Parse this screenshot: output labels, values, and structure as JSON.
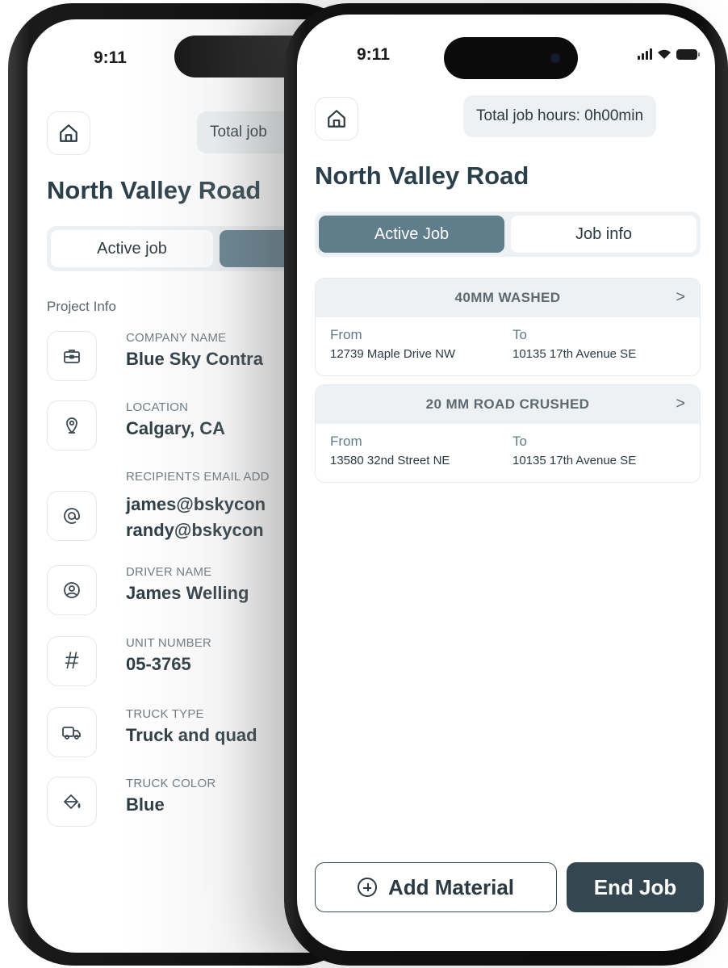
{
  "back_screen": {
    "time": "9:11",
    "hours_pill": "Total job",
    "title": "North Valley Road",
    "tabs": [
      {
        "label": "Active job",
        "active": false
      },
      {
        "label": "",
        "active": true
      }
    ],
    "section_label": "Project Info",
    "fields": [
      {
        "icon": "briefcase-icon",
        "label": "COMPANY NAME",
        "value": "Blue Sky Contra"
      },
      {
        "icon": "location-pin-icon",
        "label": "LOCATION",
        "value": "Calgary, CA"
      },
      {
        "icon": "at-sign-icon",
        "label": "RECIPIENTS EMAIL ADD",
        "value": "james@bskycon",
        "value2": "randy@bskycon"
      },
      {
        "icon": "user-circle-icon",
        "label": "DRIVER NAME",
        "value": "James Welling"
      },
      {
        "icon": "hash-icon",
        "label": "UNIT NUMBER",
        "value": "05-3765"
      },
      {
        "icon": "truck-icon",
        "label": "TRUCK TYPE",
        "value": "Truck and quad"
      },
      {
        "icon": "paint-bucket-icon",
        "label": "TRUCK COLOR",
        "value": "Blue"
      }
    ]
  },
  "front_screen": {
    "time": "9:11",
    "hours_pill": "Total job hours: 0h00min",
    "title": "North Valley Road",
    "tabs": [
      {
        "label": "Active Job",
        "active": true
      },
      {
        "label": "Job info",
        "active": false
      }
    ],
    "materials": [
      {
        "name": "40MM WASHED",
        "from_label": "From",
        "from": "12739 Maple Drive NW",
        "to_label": "To",
        "to": "10135 17th Avenue SE"
      },
      {
        "name": "20 MM ROAD CRUSHED",
        "from_label": "From",
        "from": "13580 32nd Street NE",
        "to_label": "To",
        "to": "10135 17th Avenue SE"
      }
    ],
    "add_material_label": "Add Material",
    "end_job_label": "End Job"
  },
  "colors": {
    "accent": "#5f7d8b",
    "primary_button": "#34464f",
    "text": "#2b3a42",
    "pill_bg": "#eef1f3"
  }
}
